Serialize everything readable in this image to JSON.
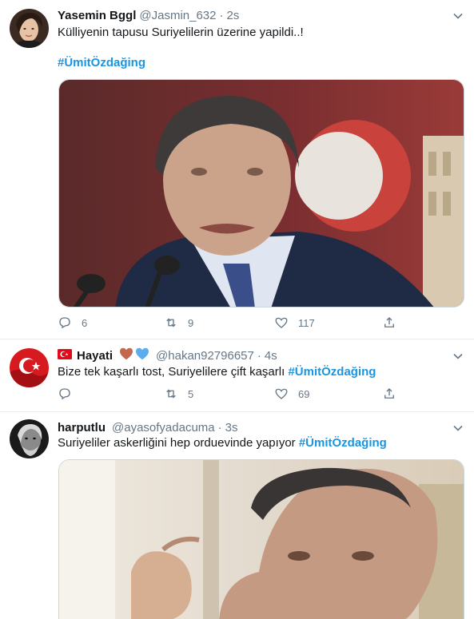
{
  "tweets": [
    {
      "name": "Yasemin Bggl",
      "handle": "@Jasmin_632",
      "dot": "·",
      "time": "2s",
      "text": "Külliyenin tapusu Suriyelilerin üzerine yapildi..!",
      "hashtag": "#ÜmitÖzdağing",
      "replies": "6",
      "retweets": "9",
      "likes": "117"
    },
    {
      "name": "Hayati",
      "handle": "@hakan92796657",
      "dot": "·",
      "time": "4s",
      "text": "Bize tek kaşarlı tost, Suriyelilere çift kaşarlı",
      "hashtag": "#ÜmitÖzdağing",
      "replies": "",
      "retweets": "5",
      "likes": "69"
    },
    {
      "name": "harputlu",
      "handle": "@ayasofyadacuma",
      "dot": "·",
      "time": "3s",
      "text": "Suriyeliler askerliğini hep orduevinde yapıyor",
      "hashtag": "#ÜmitÖzdağing"
    }
  ],
  "colors": {
    "link": "#1b95e0",
    "secondary_text": "#657786",
    "border": "#e6ecf0",
    "emoji_brown": "#c1694f",
    "emoji_blue": "#5dadec",
    "flag_red": "#e30a17"
  },
  "icons": [
    "chevron-down-icon",
    "reply-icon",
    "retweet-icon",
    "like-icon",
    "share-icon",
    "turkey-flag-icon",
    "brown-heart-icon",
    "blue-heart-icon"
  ]
}
